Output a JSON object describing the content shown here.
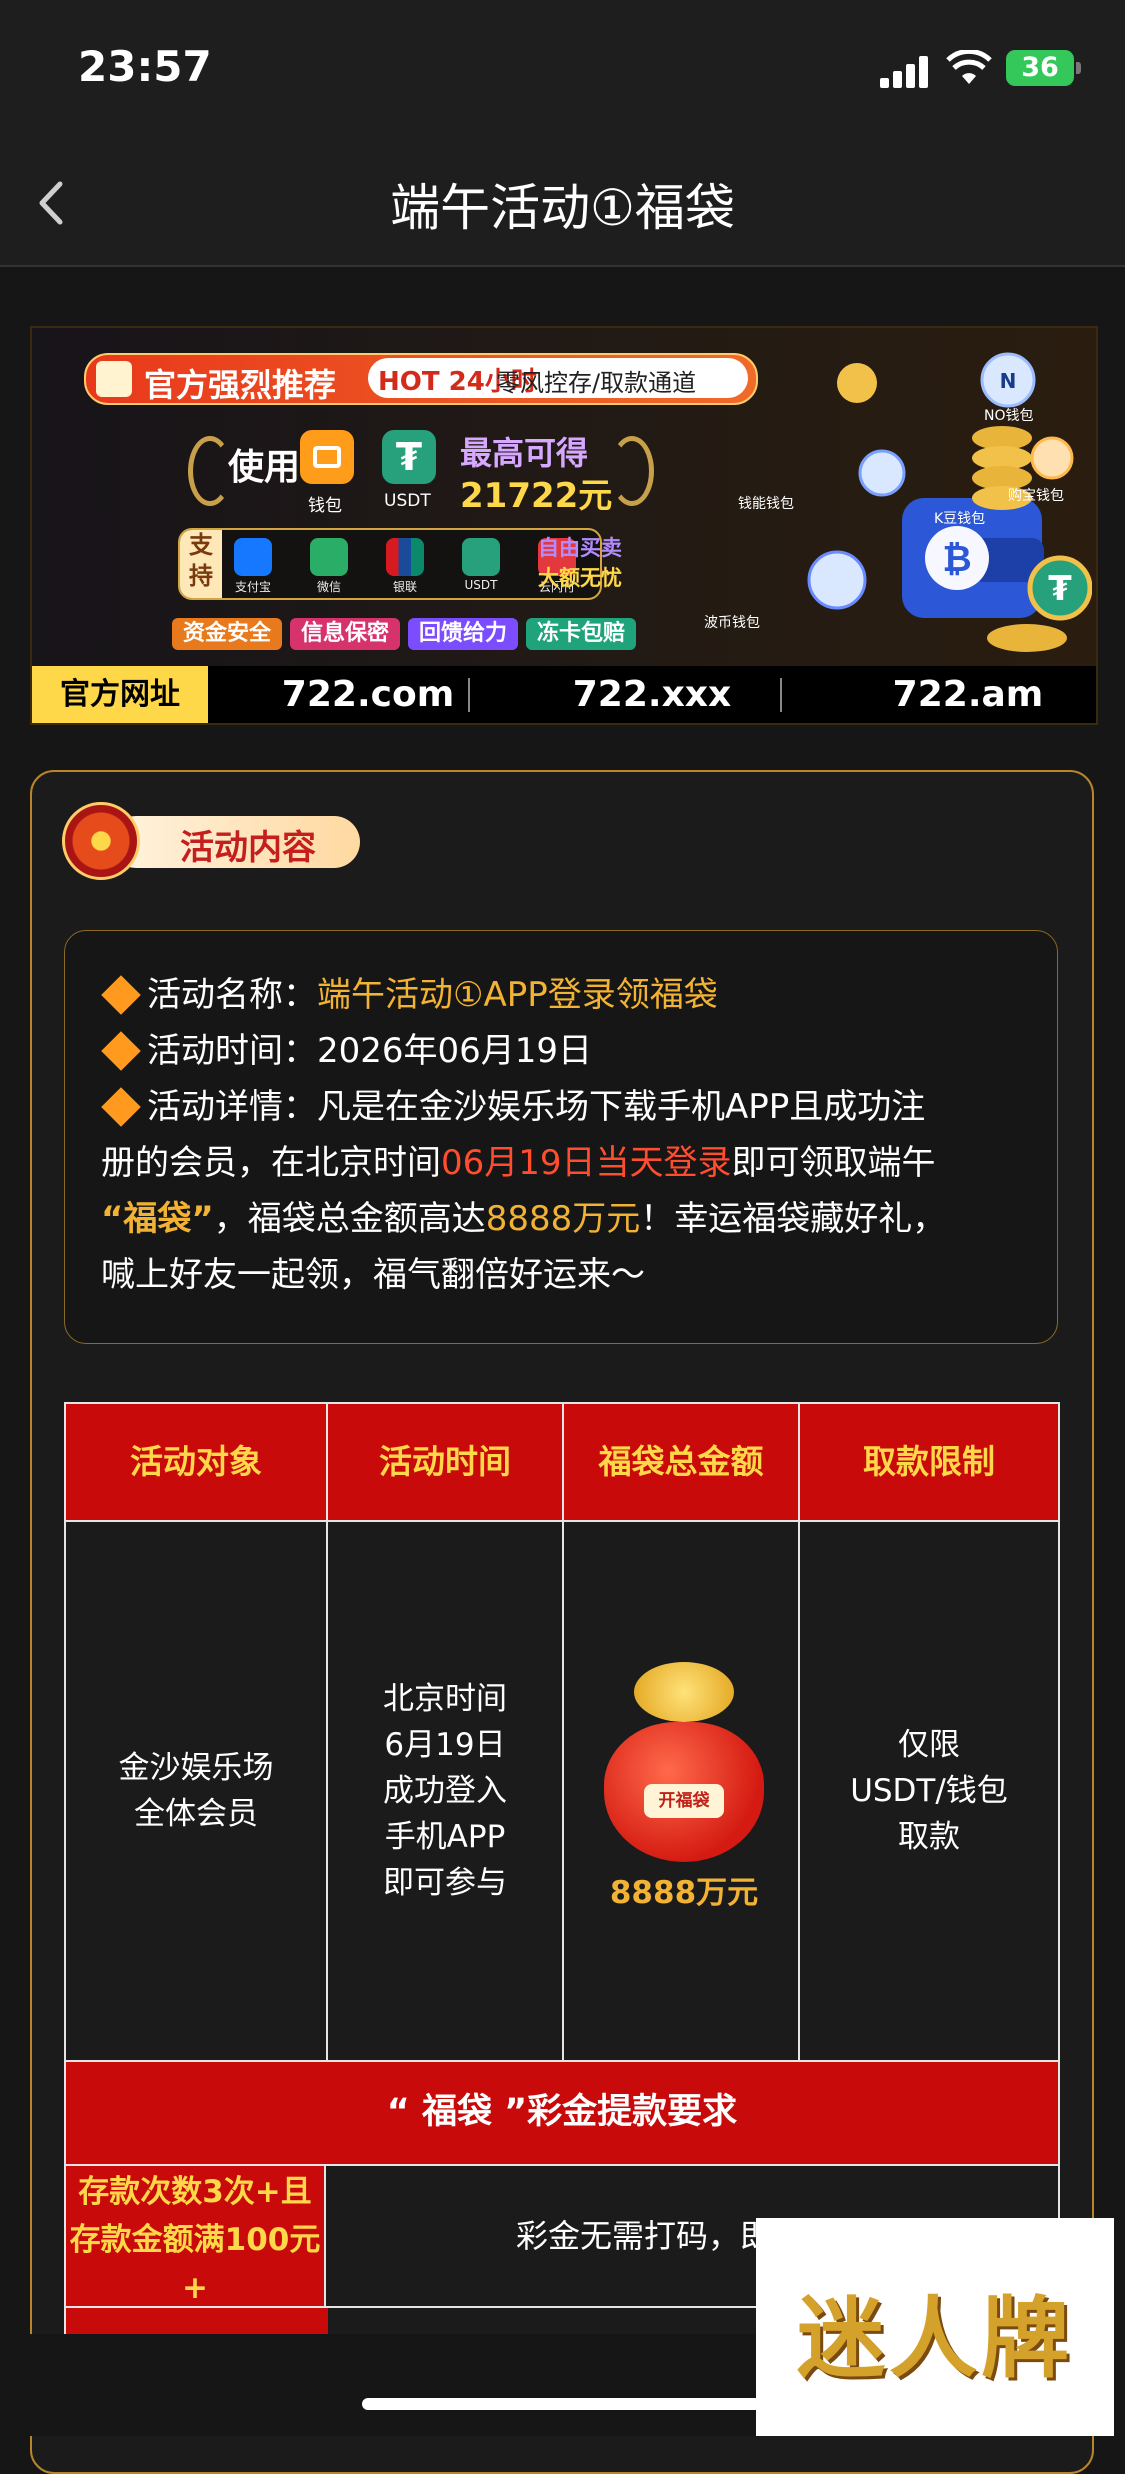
{
  "status_bar": {
    "time": "23:57",
    "battery": "36"
  },
  "nav": {
    "title": "端午活动①福袋"
  },
  "banner": {
    "recommend": "官方强烈推荐",
    "hot_badge": "HOT",
    "hot_text": "24小时",
    "hot_rest": "零风控存/取款通道",
    "use_label": "使用",
    "wallet_label": "钱包",
    "usdt_label": "USDT",
    "usdt_symbol": "₮",
    "max_label": "最高可得",
    "max_value": "21722元",
    "support_tag": "支持",
    "payments": [
      "支付宝",
      "微信",
      "银联",
      "USDT",
      "云闪付"
    ],
    "support_text1": "自由买卖",
    "support_text2": "大额无忧",
    "features": [
      "资金安全",
      "信息保密",
      "回馈给力",
      "冻卡包赔"
    ],
    "wallet_names": [
      "NO钱包",
      "钱能钱包",
      "购宝钱包",
      "K豆钱包",
      "波币钱包"
    ],
    "site_label": "官方网址",
    "sites": [
      "722.com",
      "722.xxx",
      "722.am"
    ]
  },
  "section": {
    "badge": "活动内容",
    "name_label": "活动名称：",
    "name_value": "端午活动①APP登录领福袋",
    "time_label": "活动时间：",
    "time_value": "2026年06月19日",
    "detail_label": "活动详情：",
    "detail_line1": "凡是在金沙娱乐场下载手机APP且成功注",
    "detail_line2a": "册的会员，在北京时间",
    "detail_line2b": "06月19日当天登录",
    "detail_line2c": "即可领取端午",
    "detail_line3a": "“福袋”",
    "detail_line3b": "，福袋总金额高达",
    "detail_line3c": "8888万元",
    "detail_line3d": "！幸运福袋藏好礼，",
    "detail_line4": "喊上好友一起领，福气翻倍好运来～"
  },
  "table": {
    "headers": [
      "活动对象",
      "活动时间",
      "福袋总金额",
      "取款限制"
    ],
    "target": [
      "金沙娱乐场",
      "全体会员"
    ],
    "time": [
      "北京时间",
      "6月19日",
      "成功登入",
      "手机APP",
      "即可参与"
    ],
    "bag_tag": "开福袋",
    "amount": "8888万元",
    "limit": [
      "仅限",
      "USDT/钱包",
      "取款"
    ],
    "req_header": "“ 福袋 ”彩金提款要求",
    "req_cond": [
      "存款次数3次+且",
      "存款金额满100元",
      "+"
    ],
    "req_value": "彩金无需打码，即可提款"
  },
  "watermark": "迷人牌"
}
